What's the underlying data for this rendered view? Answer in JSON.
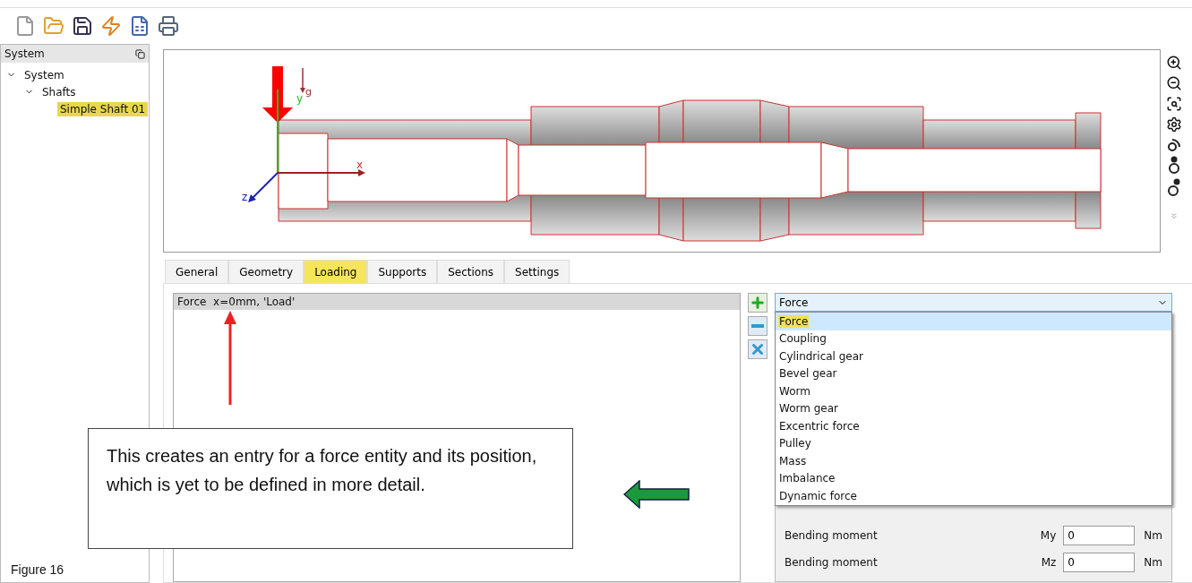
{
  "sidebar": {
    "title": "System",
    "tree": [
      {
        "label": "System",
        "expanded": true,
        "selected": false,
        "children": [
          {
            "label": "Shafts",
            "expanded": true,
            "selected": false,
            "children": [
              {
                "label": "Simple Shaft 01",
                "selected": true
              }
            ]
          }
        ]
      }
    ]
  },
  "viewport": {
    "axis_labels": {
      "x": "x",
      "y": "y",
      "z": "z"
    },
    "gravity_label": "g"
  },
  "tabs": [
    {
      "label": "General",
      "selected": false
    },
    {
      "label": "Geometry",
      "selected": false
    },
    {
      "label": "Loading",
      "selected": true
    },
    {
      "label": "Supports",
      "selected": false
    },
    {
      "label": "Sections",
      "selected": false
    },
    {
      "label": "Settings",
      "selected": false
    }
  ],
  "loads_list": {
    "items": [
      {
        "label": "Force  x=0mm, 'Load'",
        "selected": true
      }
    ]
  },
  "load_type": {
    "value": "Force",
    "expanded": true,
    "options": [
      {
        "label": "Force",
        "selected": true
      },
      {
        "label": "Coupling",
        "selected": false
      },
      {
        "label": "Cylindrical gear",
        "selected": false
      },
      {
        "label": "Bevel gear",
        "selected": false
      },
      {
        "label": "Worm",
        "selected": false
      },
      {
        "label": "Worm gear",
        "selected": false
      },
      {
        "label": "Excentric force",
        "selected": false
      },
      {
        "label": "Pulley",
        "selected": false
      },
      {
        "label": "Mass",
        "selected": false
      },
      {
        "label": "Imbalance",
        "selected": false
      },
      {
        "label": "Dynamic force",
        "selected": false
      }
    ]
  },
  "moments": [
    {
      "label": "Bending moment",
      "symbol": "My",
      "value": "0",
      "unit": "Nm"
    },
    {
      "label": "Bending moment",
      "symbol": "Mz",
      "value": "0",
      "unit": "Nm"
    }
  ],
  "callout": {
    "text": "This creates an entry for a force entity and its position, which is yet to be defined in more detail."
  },
  "caption": "Figure 16"
}
